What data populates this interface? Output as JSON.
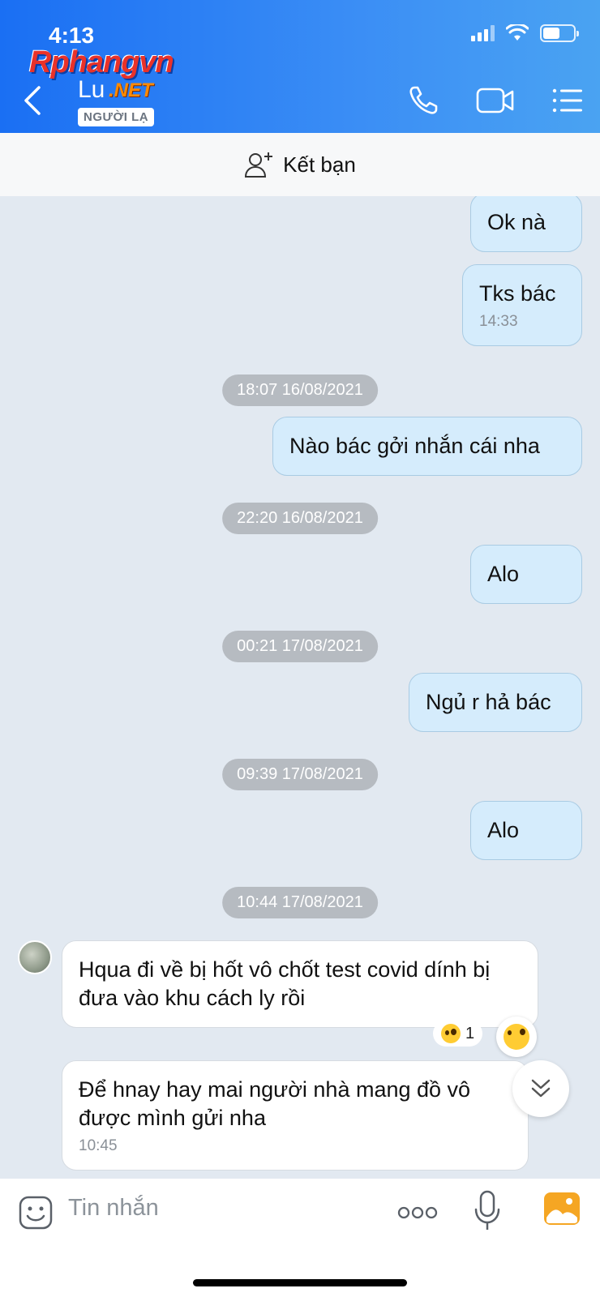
{
  "status_bar": {
    "time": "4:13"
  },
  "watermark": {
    "brand": "Rphangvn",
    "suffix": ".NET"
  },
  "header": {
    "contact_name": "Lu",
    "stranger_badge": "NGƯỜI LẠ"
  },
  "friend_bar": {
    "label": "Kết bạn"
  },
  "messages": [
    {
      "dir": "out",
      "text": "Ok nà"
    },
    {
      "dir": "out",
      "text": "Tks bác",
      "time": "14:33"
    },
    {
      "type": "date",
      "text": "18:07 16/08/2021"
    },
    {
      "dir": "out",
      "text": "Nào bác gởi nhắn cái nha"
    },
    {
      "type": "date",
      "text": "22:20 16/08/2021"
    },
    {
      "dir": "out",
      "text": "Alo"
    },
    {
      "type": "date",
      "text": "00:21 17/08/2021"
    },
    {
      "dir": "out",
      "text": "Ngủ r hả bác"
    },
    {
      "type": "date",
      "text": "09:39 17/08/2021"
    },
    {
      "dir": "out",
      "text": "Alo"
    },
    {
      "type": "date",
      "text": "10:44 17/08/2021"
    },
    {
      "dir": "in",
      "text": "Hqua đi về bị hốt vô chốt test covid dính bị đưa vào khu cách ly rồi",
      "reaction_count": "1"
    },
    {
      "dir": "in",
      "text": "Để hnay hay mai người nhà mang đồ vô được mình gửi nha",
      "time": "10:45"
    }
  ],
  "input": {
    "placeholder": "Tin nhắn"
  },
  "icons": {
    "back": "chevron-left-icon",
    "call": "phone-icon",
    "video": "video-camera-icon",
    "menu": "list-menu-icon",
    "add_friend": "add-user-icon",
    "sticker": "sticker-icon",
    "more": "more-dots-icon",
    "mic": "microphone-icon",
    "image": "image-gallery-icon",
    "scroll": "double-chevron-down-icon"
  },
  "colors": {
    "header_start": "#1a6ff3",
    "header_end": "#4aa3f2",
    "outgoing_bubble": "#d5ecfc",
    "incoming_bubble": "#ffffff",
    "chat_bg": "#e2e9f1",
    "image_icon": "#f5a623"
  }
}
